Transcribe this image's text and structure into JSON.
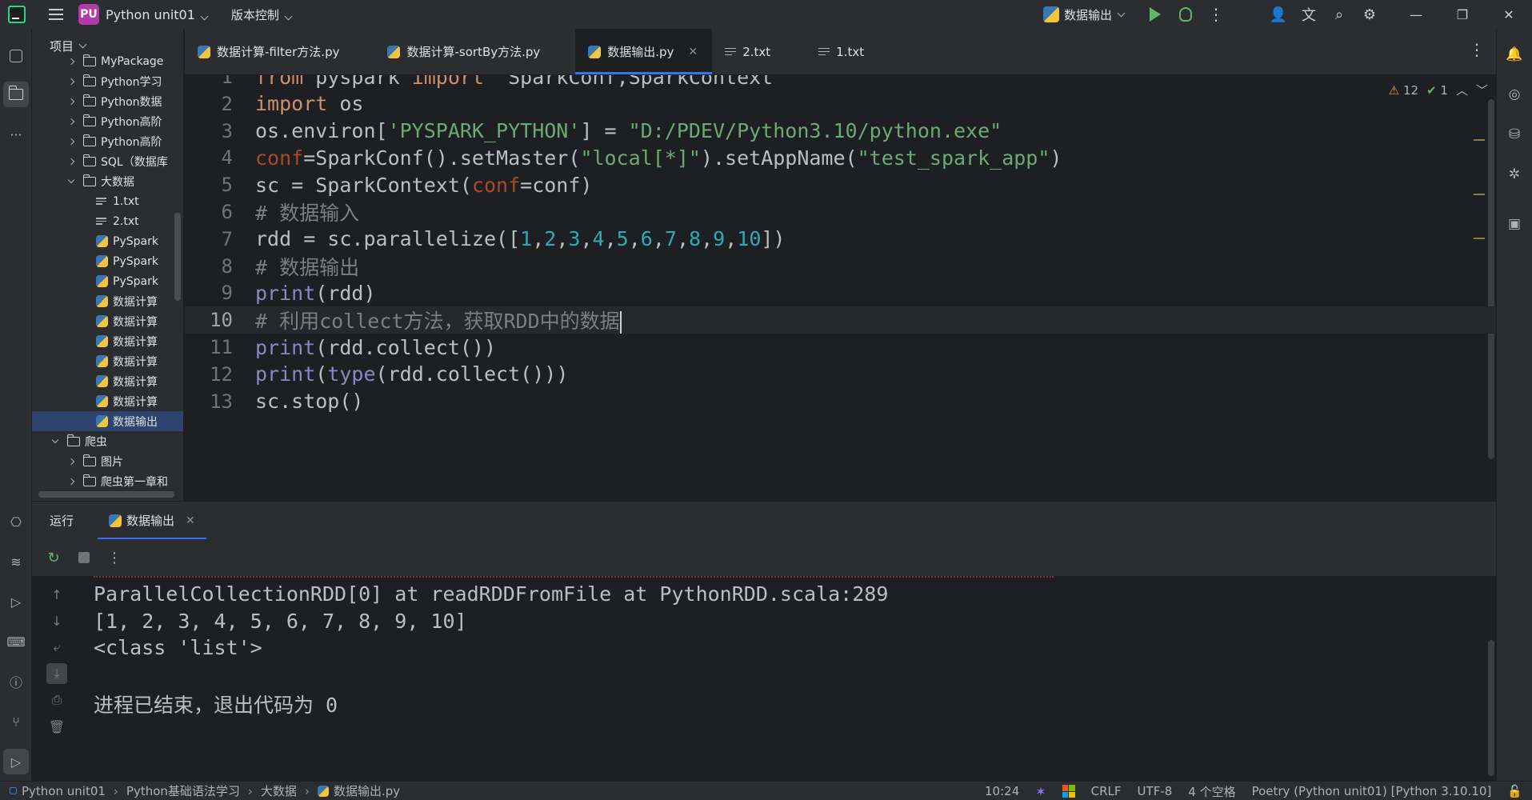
{
  "titlebar": {
    "project_badge": "PU",
    "project_name": "Python unit01",
    "vcs": "版本控制",
    "run_config": "数据输出"
  },
  "project_panel": {
    "title": "项目",
    "tree": [
      {
        "label": "MyPackage",
        "type": "folder",
        "state": "collapsed"
      },
      {
        "label": "Python学习",
        "type": "folder",
        "state": "collapsed"
      },
      {
        "label": "Python数据",
        "type": "folder",
        "state": "collapsed"
      },
      {
        "label": "Python高阶",
        "type": "folder",
        "state": "collapsed"
      },
      {
        "label": "Python高阶",
        "type": "folder",
        "state": "collapsed"
      },
      {
        "label": "SQL（数据库",
        "type": "folder",
        "state": "collapsed"
      },
      {
        "label": "大数据",
        "type": "folder",
        "state": "expanded"
      },
      {
        "label": "1.txt",
        "type": "text"
      },
      {
        "label": "2.txt",
        "type": "text"
      },
      {
        "label": "PySpark",
        "type": "python"
      },
      {
        "label": "PySpark",
        "type": "python"
      },
      {
        "label": "PySpark",
        "type": "python"
      },
      {
        "label": "数据计算",
        "type": "python"
      },
      {
        "label": "数据计算",
        "type": "python"
      },
      {
        "label": "数据计算",
        "type": "python"
      },
      {
        "label": "数据计算",
        "type": "python"
      },
      {
        "label": "数据计算",
        "type": "python"
      },
      {
        "label": "数据计算",
        "type": "python"
      },
      {
        "label": "数据输出",
        "type": "python",
        "selected": true
      },
      {
        "label": "爬虫",
        "type": "folder",
        "state": "expanded"
      },
      {
        "label": "图片",
        "type": "folder",
        "state": "collapsed"
      },
      {
        "label": "爬虫第一章和",
        "type": "folder",
        "state": "collapsed"
      }
    ]
  },
  "tabs": [
    {
      "label": "数据计算-filter方法.py",
      "type": "python"
    },
    {
      "label": "数据计算-sortBy方法.py",
      "type": "python"
    },
    {
      "label": "数据输出.py",
      "type": "python",
      "active": true
    },
    {
      "label": "2.txt",
      "type": "text"
    },
    {
      "label": "1.txt",
      "type": "text"
    }
  ],
  "inspections": {
    "warnings": "12",
    "ok": "1"
  },
  "editor": {
    "current_line": 10,
    "lines": [
      {
        "n": "1",
        "text": "from pyspark import  SparkConf,SparkContext"
      },
      {
        "n": "2",
        "text": "import os"
      },
      {
        "n": "3",
        "text": "os.environ['PYSPARK_PYTHON'] = \"D:/PDEV/Python3.10/python.exe\""
      },
      {
        "n": "4",
        "text": "conf=SparkConf().setMaster(\"local[*]\").setAppName(\"test_spark_app\")"
      },
      {
        "n": "5",
        "text": "sc = SparkContext(conf=conf)"
      },
      {
        "n": "6",
        "text": "# 数据输入"
      },
      {
        "n": "7",
        "text": "rdd = sc.parallelize([1,2,3,4,5,6,7,8,9,10])"
      },
      {
        "n": "8",
        "text": "# 数据输出"
      },
      {
        "n": "9",
        "text": "print(rdd)"
      },
      {
        "n": "10",
        "text": "# 利用collect方法，获取RDD中的数据"
      },
      {
        "n": "11",
        "text": "print(rdd.collect())"
      },
      {
        "n": "12",
        "text": "print(type(rdd.collect()))"
      },
      {
        "n": "13",
        "text": "sc.stop()"
      }
    ]
  },
  "run_panel": {
    "title": "运行",
    "tab": "数据输出",
    "console": [
      "ParallelCollectionRDD[0] at readRDDFromFile at PythonRDD.scala:289",
      "[1, 2, 3, 4, 5, 6, 7, 8, 9, 10]",
      "<class 'list'>",
      "",
      "进程已结束，退出代码为 0"
    ]
  },
  "statusbar": {
    "breadcrumbs": [
      "Python unit01",
      "Python基础语法学习",
      "大数据",
      "数据输出.py"
    ],
    "position": "10:24",
    "line_sep": "CRLF",
    "encoding": "UTF-8",
    "indent": "4 个空格",
    "interpreter": "Poetry (Python unit01) [Python 3.10.10]"
  }
}
